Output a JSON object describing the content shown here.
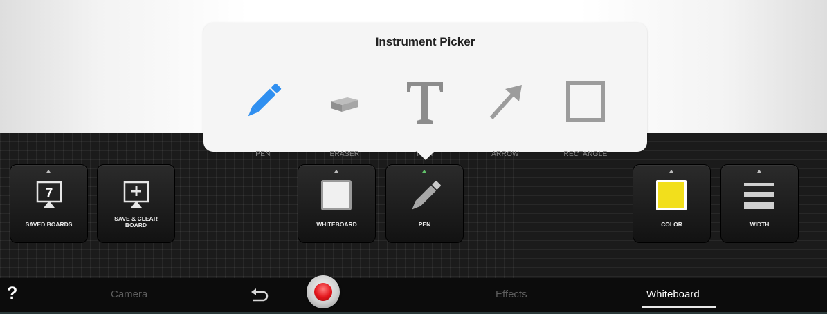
{
  "popover": {
    "title": "Instrument Picker",
    "instruments": [
      {
        "label": "PEN",
        "icon": "pen-icon",
        "selected": true
      },
      {
        "label": "ERASER",
        "icon": "eraser-icon"
      },
      {
        "label": "TEXT",
        "icon": "text-icon"
      },
      {
        "label": "ARROW",
        "icon": "arrow-icon"
      },
      {
        "label": "RECTANGLE",
        "icon": "rectangle-icon"
      }
    ]
  },
  "tools": {
    "saved_boards": {
      "label": "SAVED BOARDS",
      "count": "7"
    },
    "save_clear": {
      "line1": "SAVE & CLEAR",
      "line2": "BOARD"
    },
    "whiteboard": {
      "label": "WHITEBOARD"
    },
    "pen": {
      "label": "PEN"
    },
    "color": {
      "label": "COLOR",
      "value": "#f2df1c"
    },
    "width": {
      "label": "WIDTH"
    }
  },
  "bottombar": {
    "help": "?",
    "tabs": [
      "Camera",
      "Effects",
      "Whiteboard"
    ],
    "active_tab": "Whiteboard"
  },
  "colors": {
    "accent_blue": "#2f8ff0",
    "selected_indicator": "#62c46b",
    "record_red": "#e3161c"
  }
}
